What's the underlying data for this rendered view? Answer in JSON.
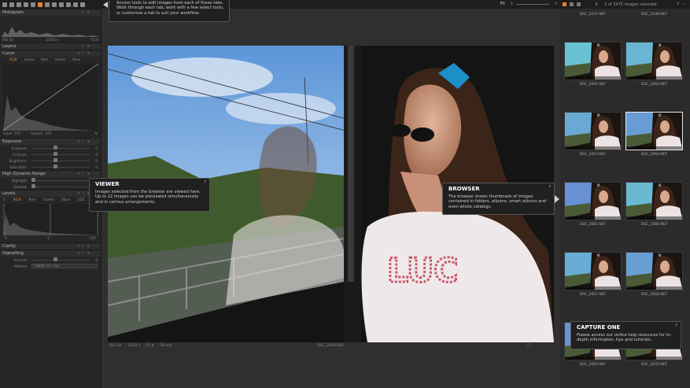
{
  "topbar": {
    "fit_label": "Fit",
    "count_label": "1 of 3475 images selected"
  },
  "left": {
    "histogram_title": "Histogram",
    "hist_iso": "ISO 64",
    "hist_shutter": "1/250 s",
    "hist_aperture": "f/2.8",
    "layers_title": "Layers",
    "curve_title": "Curve",
    "curve_tabs": [
      "RGB",
      "Luma",
      "Red",
      "Green",
      "Blue"
    ],
    "curve_input": "Input",
    "curve_input_val": "155",
    "curve_output": "Output",
    "curve_output_val": "155",
    "exposure_title": "Exposure",
    "exposure_sliders": [
      {
        "label": "Exposure",
        "value": "0"
      },
      {
        "label": "Contrast",
        "value": "0"
      },
      {
        "label": "Brightness",
        "value": "0"
      },
      {
        "label": "Saturation",
        "value": "0"
      }
    ],
    "hdr_title": "High Dynamic Range",
    "hdr_sliders": [
      {
        "label": "Highlight",
        "value": "0"
      },
      {
        "label": "Shadow",
        "value": "0"
      }
    ],
    "levels_title": "Levels",
    "levels_tabs": [
      "0",
      "RGB",
      "Red",
      "Green",
      "Blue",
      "255"
    ],
    "levels_vals": [
      "0",
      "1",
      "255"
    ],
    "clarity_title": "Clarity",
    "vignetting_title": "Vignetting",
    "vig_amount_label": "Amount",
    "vig_amount_val": "0",
    "vig_method_label": "Method",
    "vig_method_val": "Elliptic on Crop"
  },
  "tooltip_tools": {
    "text": "Access tools to edit images from each of these tabs. Work through each tab, work with a few select tools, or customize a tab to suit your workflow."
  },
  "viewer_box": {
    "title": "VIEWER",
    "text": "Images selected from the browser are viewed here. Up to 12 images can be previewed simultaneously and in various arrangements.",
    "q": "?"
  },
  "browser_box": {
    "title": "BROWSER",
    "text": "The browser shows thumbnails of images contained in folders, albums, smart albums and even whole catalogs.",
    "q": "?"
  },
  "capture_box": {
    "title": "CAPTURE ONE",
    "text": "Please access our online help resources for in-depth information, tips and tutorials.",
    "q": "?"
  },
  "viewer": {
    "iso": "ISO 64",
    "shutter": "1/250 s",
    "aperture": "f/2.8",
    "focal": "28 mm",
    "filename": "DSC_2664.NEF"
  },
  "browser": {
    "top_names": [
      "DSC_2437.NEF",
      "DSC_2438.NEF"
    ],
    "thumbs": [
      {
        "name": "DSC_2661.NEF"
      },
      {
        "name": "DSC_2662.NEF"
      },
      {
        "name": "DSC_2663.NEF"
      },
      {
        "name": "DSC_2664.NEF"
      },
      {
        "name": "DSC_2665.NEF"
      },
      {
        "name": "DSC_2666.NEF"
      },
      {
        "name": "DSC_2667.NEF"
      },
      {
        "name": "DSC_2668.NEF"
      },
      {
        "name": "DSC_2669.NEF"
      },
      {
        "name": "DSC_2670.NEF"
      }
    ]
  },
  "colors": {
    "accent": "#e8822a",
    "panel": "#262626",
    "viewer_bg": "#2f2f2f"
  }
}
